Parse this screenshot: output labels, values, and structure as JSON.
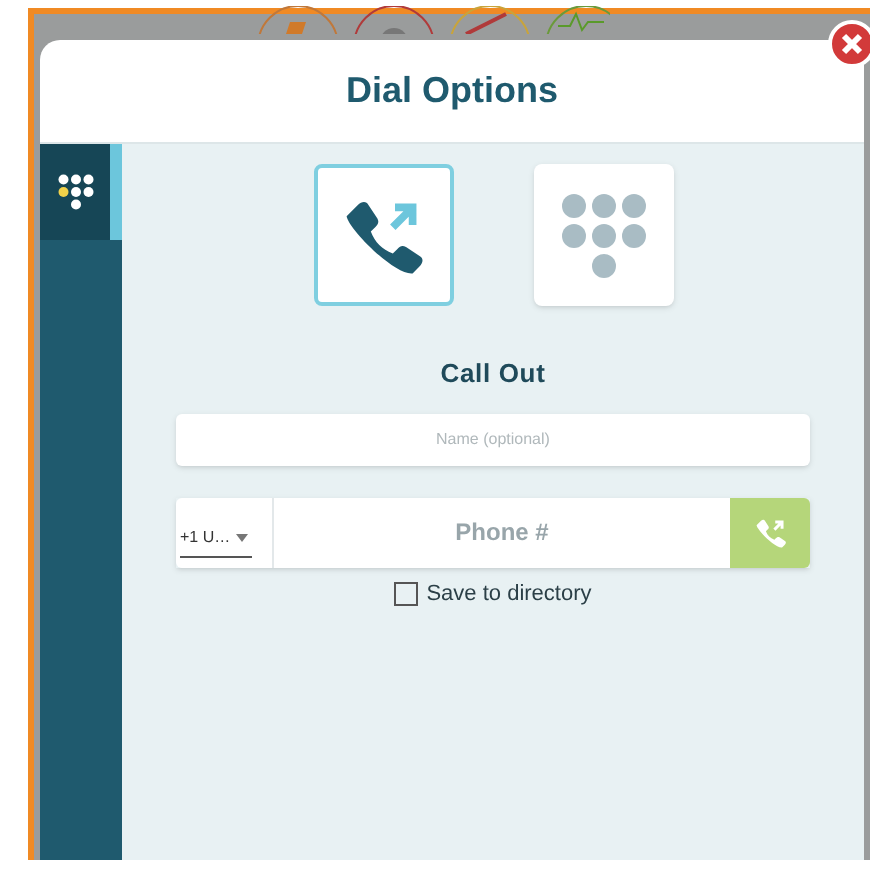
{
  "dialog": {
    "title": "Dial Options"
  },
  "sidebar": {
    "items": [
      {
        "kind": "keypad",
        "selected": true
      }
    ]
  },
  "modes": [
    {
      "kind": "call-out",
      "selected": true
    },
    {
      "kind": "keypad",
      "selected": false
    }
  ],
  "heading": "Call Out",
  "name_field": {
    "placeholder": "Name (optional)"
  },
  "country_select": {
    "value": "+1 U…"
  },
  "phone_field": {
    "placeholder": "Phone #"
  },
  "save_to_directory": {
    "label": "Save to directory",
    "checked": false
  }
}
